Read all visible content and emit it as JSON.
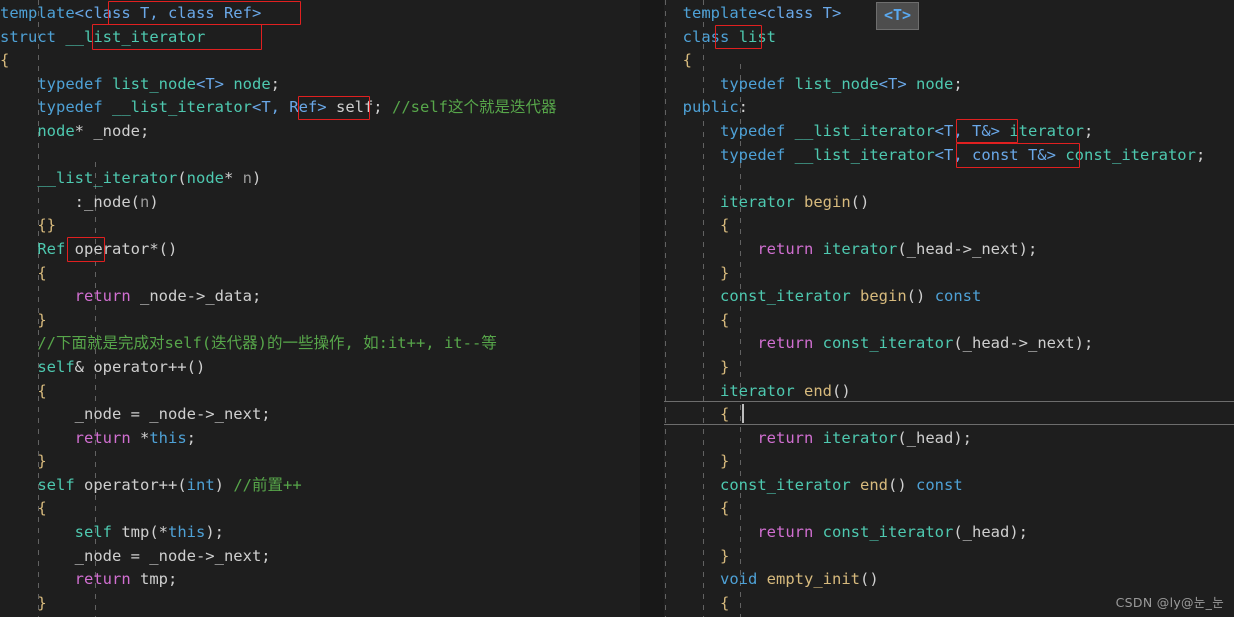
{
  "editor": {
    "background": "#1e1e1e",
    "divider_color": "#181818",
    "accent_annotation_color": "#e02020",
    "font_size_px": 15.5,
    "line_height_px": 23.6
  },
  "left_pane": {
    "name": "__list_iterator source pane",
    "lines": [
      "template<class T, class Ref>",
      "struct __list_iterator",
      "{",
      "    typedef list_node<T> node;",
      "    typedef __list_iterator<T, Ref> self; //self这个就是迭代器",
      "    node* _node;",
      "",
      "    __list_iterator(node* n)",
      "        :_node(n)",
      "    {}",
      "    Ref operator*()",
      "    {",
      "        return _node->_data;",
      "    }",
      "    //下面就是完成对self(迭代器)的一些操作, 如:it++, it--等",
      "    self& operator++()",
      "    {",
      "        _node = _node->_next;",
      "        return *this;",
      "    }",
      "    self operator++(int) //前置++",
      "    {",
      "        self tmp(*this);",
      "        _node = _node->_next;",
      "        return tmp;",
      "    }"
    ],
    "annotations": [
      {
        "label": "<class T, class Ref>",
        "line": 0
      },
      {
        "label": "__list_iterator",
        "line": 1
      },
      {
        "label": "<T, Ref>",
        "line": 4
      },
      {
        "label": "Ref",
        "line": 10
      }
    ]
  },
  "right_pane": {
    "name": "list class source pane",
    "lines": [
      "template<class T>",
      "class list",
      "{",
      "    typedef list_node<T> node;",
      "public:",
      "    typedef __list_iterator<T, T&> iterator;",
      "    typedef __list_iterator<T, const T&> const_iterator;",
      "",
      "    iterator begin()",
      "    {",
      "        return iterator(_head->_next);",
      "    }",
      "    const_iterator begin() const",
      "    {",
      "        return const_iterator(_head->_next);",
      "    }",
      "    iterator end()",
      "    {",
      "        return iterator(_head);",
      "    }",
      "    const_iterator end() const",
      "    {",
      "        return const_iterator(_head);",
      "    }",
      "    void empty_init()",
      "    {"
    ],
    "annotations": [
      {
        "label": "list",
        "line": 1
      },
      {
        "label": "<T, T&>",
        "line": 5
      },
      {
        "label": "<T, const T&>",
        "line": 6
      }
    ],
    "hint_badge": {
      "text": "<T>"
    },
    "current_line_index": 17
  },
  "watermark": {
    "text": "CSDN @ly@눈_눈"
  }
}
